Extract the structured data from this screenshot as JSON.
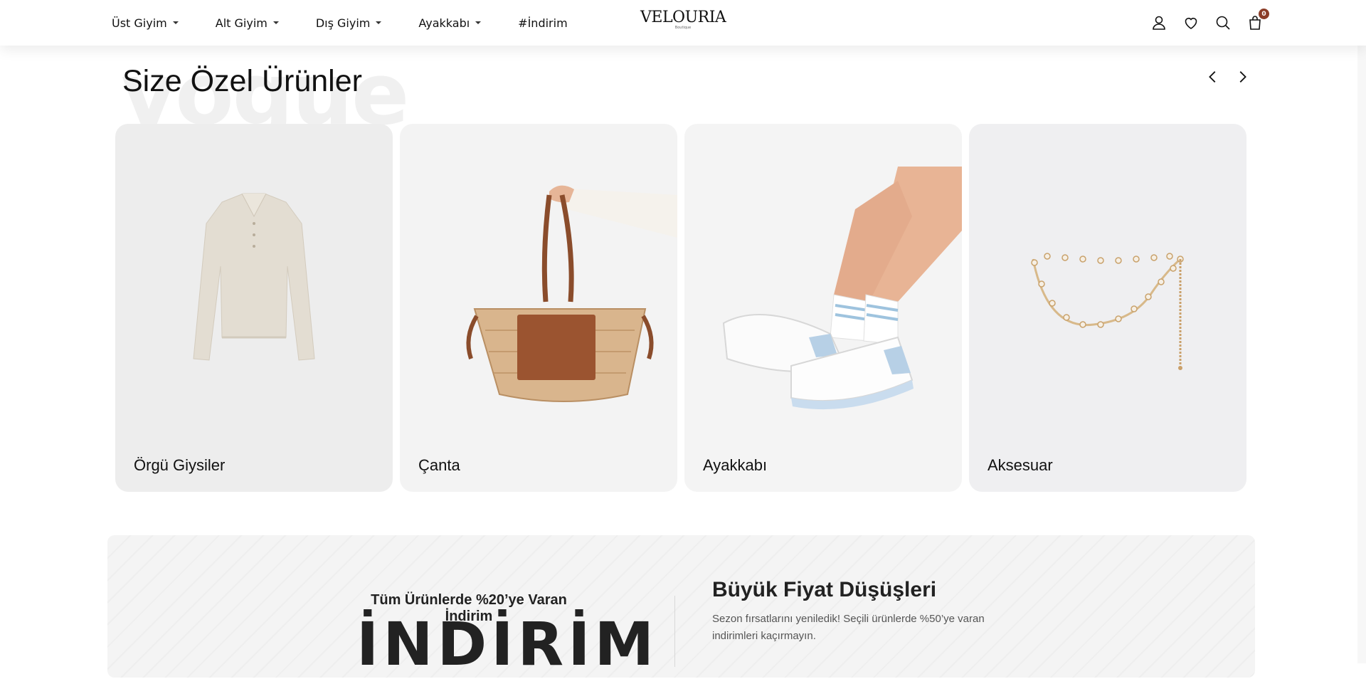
{
  "header": {
    "nav": [
      {
        "label": "Üst Giyim",
        "has_dropdown": true
      },
      {
        "label": "Alt Giyim",
        "has_dropdown": true
      },
      {
        "label": "Dış Giyim",
        "has_dropdown": true
      },
      {
        "label": "Ayakkabı",
        "has_dropdown": true
      },
      {
        "label": "#İndirim",
        "has_dropdown": false
      }
    ],
    "logo": {
      "name": "VELOURIA",
      "sub": "Boutique"
    },
    "icons": [
      "user-icon",
      "heart-icon",
      "search-icon",
      "cart-icon"
    ],
    "cart_count": "0"
  },
  "section": {
    "watermark": "vogue",
    "title": "Size Özel Ürünler",
    "arrows": [
      "chevron-left-icon",
      "chevron-right-icon"
    ]
  },
  "categories": [
    {
      "label": "Örgü Giysiler",
      "bg": "#ededed"
    },
    {
      "label": "Çanta",
      "bg": "#f3f3f3"
    },
    {
      "label": "Ayakkabı",
      "bg": "#f4f4f4"
    },
    {
      "label": "Aksesuar",
      "bg": "#efeff1"
    }
  ],
  "promo": {
    "subtitle": "Tüm Ürünlerde %20’ye Varan İndirim",
    "big": "İNDİRİM",
    "title": "Büyük Fiyat Düşüşleri",
    "text": "Sezon fırsatlarını yeniledik! Seçili ürünlerde %50’ye varan indirimleri kaçırmayın."
  },
  "colors": {
    "accent": "#8b3d28",
    "text": "#111111"
  }
}
